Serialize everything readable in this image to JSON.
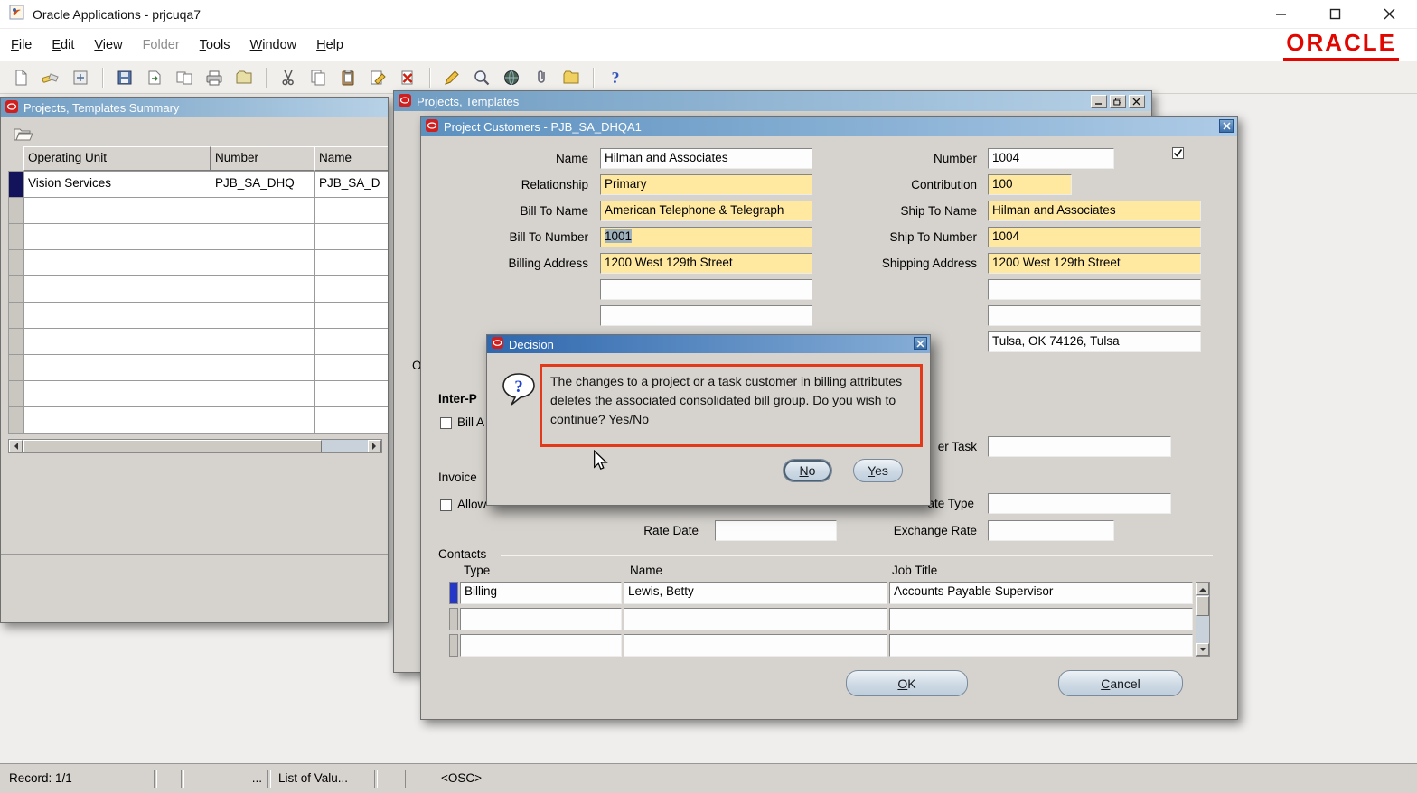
{
  "os": {
    "title": "Oracle Applications - prjcuqa7"
  },
  "menu": {
    "items": [
      {
        "first": "F",
        "rest": "ile"
      },
      {
        "first": "E",
        "rest": "dit"
      },
      {
        "first": "V",
        "rest": "iew"
      },
      {
        "first": "",
        "rest": "Folder"
      },
      {
        "first": "T",
        "rest": "ools"
      },
      {
        "first": "W",
        "rest": "indow"
      },
      {
        "first": "H",
        "rest": "elp"
      }
    ],
    "logo": "ORACLE"
  },
  "toolbar": {
    "icons": [
      "new",
      "find",
      "navigator",
      "save",
      "next-step",
      "switch-responsibility",
      "print",
      "close-form",
      "cut",
      "copy",
      "paste",
      "clear-record",
      "delete-record",
      "edit-field",
      "zoom",
      "translations",
      "attachments",
      "folder-tools",
      "help"
    ]
  },
  "summary": {
    "title": "Projects, Templates Summary",
    "headers": [
      "Operating Unit",
      "Number",
      "Name"
    ],
    "row": [
      "Vision Services",
      "PJB_SA_DHQ",
      "PJB_SA_D"
    ]
  },
  "detail": {
    "title": "Projects, Templates",
    "fragment": "O"
  },
  "cust": {
    "title": "Project Customers - PJB_SA_DHQA1",
    "labels": {
      "name": "Name",
      "number": "Number",
      "relationship": "Relationship",
      "contribution": "Contribution",
      "bill_to_name": "Bill To Name",
      "ship_to_name": "Ship To Name",
      "bill_to_number": "Bill To Number",
      "ship_to_number": "Ship To Number",
      "billing_address": "Billing Address",
      "shipping_address": "Shipping Address",
      "inter_p": "Inter-P",
      "bill_a": "Bill A",
      "invoice": "Invoice",
      "allow": "Allow",
      "task_fragment": "er Task",
      "rate_type_fragment": "ate Type",
      "rate_date": "Rate Date",
      "exchange_rate": "Exchange Rate",
      "contacts": "Contacts",
      "col_type": "Type",
      "col_name": "Name",
      "col_job_title": "Job Title"
    },
    "values": {
      "name": "Hilman and Associates",
      "number": "1004",
      "relationship": "Primary",
      "contribution": "100",
      "bill_to_name": "American Telephone & Telegraph",
      "ship_to_name": "Hilman and Associates",
      "bill_to_number": "1001",
      "ship_to_number": "1004",
      "billing_address": "1200 West 129th Street",
      "shipping_address": "1200 West 129th Street",
      "city": "Tulsa, OK 74126, Tulsa"
    },
    "contacts_rows": [
      {
        "type": "Billing",
        "name": "Lewis, Betty",
        "job": "Accounts Payable Supervisor"
      }
    ],
    "ok": {
      "first": "O",
      "rest": "K"
    },
    "cancel": {
      "first": "C",
      "rest": "ancel"
    }
  },
  "dialog": {
    "title": "Decision",
    "message": "The changes to a project or a task customer in billing attributes deletes the associated consolidated bill group. Do you wish to continue? Yes/No",
    "no": {
      "first": "N",
      "rest": "o"
    },
    "yes": {
      "first": "Y",
      "rest": "es"
    }
  },
  "status": {
    "record": "Record: 1/1",
    "dots": "...",
    "lov": "List of Valu...",
    "osc": "<OSC>"
  }
}
